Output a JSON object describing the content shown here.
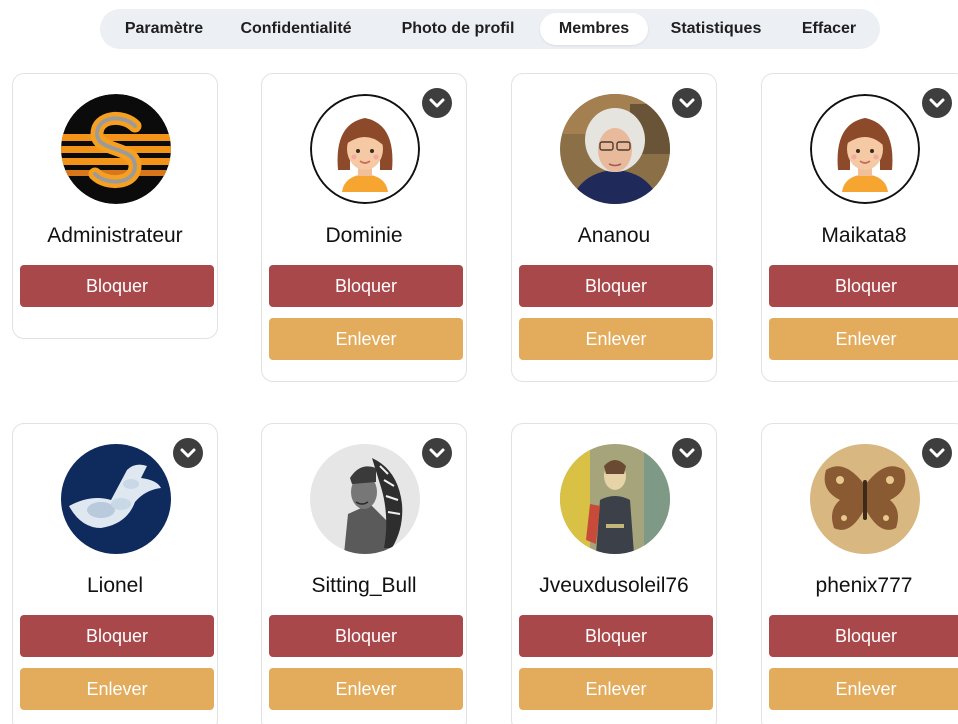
{
  "tabs": [
    {
      "label": "Paramètre",
      "active": false
    },
    {
      "label": "Confidentialité",
      "active": false
    },
    {
      "label": "Photo de profil",
      "active": false
    },
    {
      "label": "Membres",
      "active": true
    },
    {
      "label": "Statistiques",
      "active": false
    },
    {
      "label": "Effacer",
      "active": false
    }
  ],
  "members": [
    {
      "name": "Administrateur",
      "avatar": "logo-s",
      "has_menu": false,
      "has_remove": false
    },
    {
      "name": "Dominie",
      "avatar": "girl-cartoon",
      "has_menu": true,
      "has_remove": true
    },
    {
      "name": "Ananou",
      "avatar": "woman-photo",
      "has_menu": true,
      "has_remove": true
    },
    {
      "name": "Maikata8",
      "avatar": "girl-cartoon",
      "has_menu": true,
      "has_remove": true
    },
    {
      "name": "Lionel",
      "avatar": "cloud-dove",
      "has_menu": true,
      "has_remove": true
    },
    {
      "name": "Sitting_Bull",
      "avatar": "chief-photo",
      "has_menu": true,
      "has_remove": true
    },
    {
      "name": "Jveuxdusoleil76",
      "avatar": "painting",
      "has_menu": true,
      "has_remove": true
    },
    {
      "name": "phenix777",
      "avatar": "butterfly",
      "has_menu": true,
      "has_remove": true
    }
  ],
  "labels": {
    "block": "Bloquer",
    "remove": "Enlever"
  },
  "colors": {
    "block_button": "#a8484b",
    "remove_button": "#e2ac5c",
    "tabbar_bg": "#eceff3",
    "menu_button": "#3e3e3e"
  },
  "icons": {
    "menu": "chevron-down-icon"
  }
}
